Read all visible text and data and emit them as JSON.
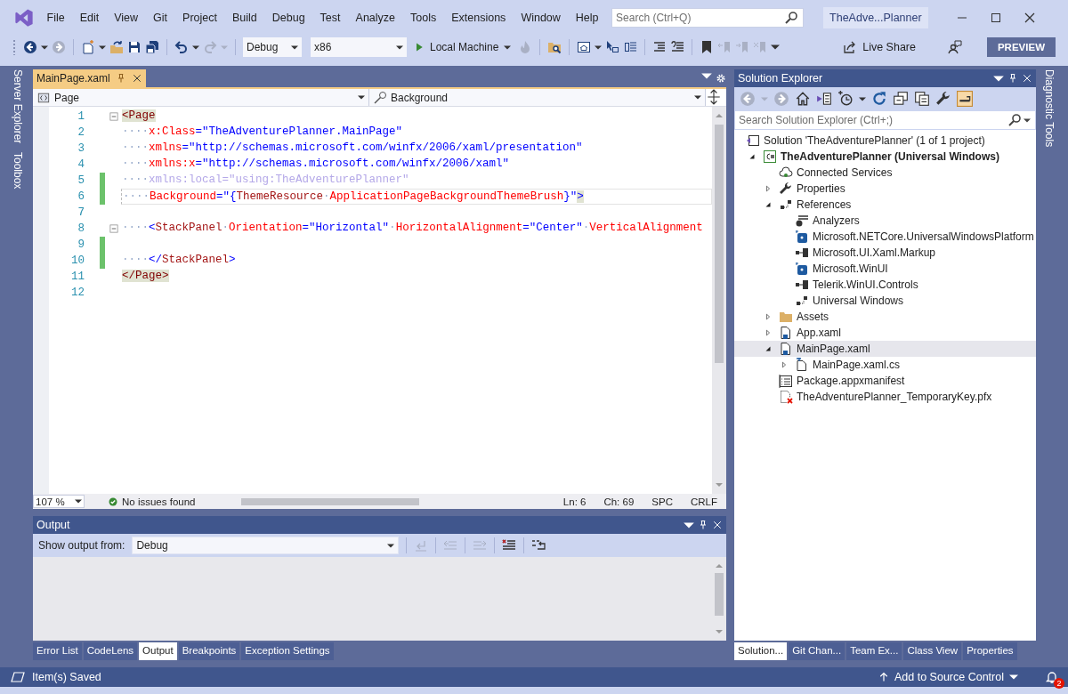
{
  "window": {
    "title": "TheAdve...Planner",
    "search": {
      "placeholder": "Search (Ctrl+Q)"
    }
  },
  "menu": [
    "File",
    "Edit",
    "View",
    "Git",
    "Project",
    "Build",
    "Debug",
    "Test",
    "Analyze",
    "Tools",
    "Extensions",
    "Window",
    "Help"
  ],
  "toolbar": {
    "left_groups": [
      [
        {
          "kind": "back",
          "disabled": false
        },
        {
          "kind": "forward",
          "disabled": true
        }
      ],
      [
        {
          "kind": "new-item",
          "disabled": false
        },
        {
          "kind": "open",
          "disabled": false
        },
        {
          "kind": "save",
          "disabled": false
        },
        {
          "kind": "save-all",
          "disabled": false
        }
      ],
      [
        {
          "kind": "undo",
          "disabled": false
        },
        {
          "kind": "redo",
          "disabled": true
        }
      ]
    ],
    "configuration": "Debug",
    "platform": "x86",
    "run_target": "Local Machine",
    "right_groups": [
      [
        {
          "kind": "flame",
          "disabled": true
        }
      ],
      [
        {
          "kind": "folder-search",
          "disabled": false
        }
      ],
      [
        {
          "kind": "window-home",
          "disabled": false
        },
        {
          "kind": "pointer",
          "disabled": false
        },
        {
          "kind": "list",
          "disabled": false
        }
      ],
      [
        {
          "kind": "indent",
          "disabled": false
        },
        {
          "kind": "comment",
          "disabled": false
        }
      ],
      [
        {
          "kind": "bookmark",
          "disabled": false
        },
        {
          "kind": "bookmark-prev",
          "disabled": true
        },
        {
          "kind": "bookmark-next",
          "disabled": true
        },
        {
          "kind": "bookmark-clear",
          "disabled": true
        }
      ]
    ],
    "live_share": "Live Share",
    "preview": "PREVIEW"
  },
  "side_tabs": {
    "left": [
      "Server Explorer",
      "Toolbox"
    ],
    "right": [
      "Diagnostic Tools"
    ]
  },
  "editor": {
    "tab": {
      "label": "MainPage.xaml",
      "selected": true
    },
    "nav": {
      "scope": "Page",
      "member": "Background"
    },
    "lines": [
      {
        "number": "1",
        "changed": false,
        "collapsible": true,
        "current": false,
        "tokens": [
          {
            "kind": "matched-tag",
            "text": "<Page"
          }
        ]
      },
      {
        "number": "2",
        "changed": false,
        "collapsible": false,
        "current": false,
        "tokens": [
          {
            "kind": "space",
            "text": "····"
          },
          {
            "kind": "attr",
            "text": "x:Class"
          },
          {
            "kind": "punct",
            "text": "="
          },
          {
            "kind": "value",
            "text": "\"TheAdventurePlanner.MainPage\""
          }
        ]
      },
      {
        "number": "3",
        "changed": false,
        "collapsible": false,
        "current": false,
        "tokens": [
          {
            "kind": "space",
            "text": "····"
          },
          {
            "kind": "attr",
            "text": "xmlns"
          },
          {
            "kind": "punct",
            "text": "="
          },
          {
            "kind": "value",
            "text": "\"http://schemas.microsoft.com/winfx/2006/xaml/presentation\""
          }
        ]
      },
      {
        "number": "4",
        "changed": false,
        "collapsible": false,
        "current": false,
        "tokens": [
          {
            "kind": "space",
            "text": "····"
          },
          {
            "kind": "attr",
            "text": "xmlns:x"
          },
          {
            "kind": "punct",
            "text": "="
          },
          {
            "kind": "value",
            "text": "\"http://schemas.microsoft.com/winfx/2006/xaml\""
          }
        ]
      },
      {
        "number": "5",
        "changed": true,
        "collapsible": false,
        "current": false,
        "tokens": [
          {
            "kind": "space",
            "text": "····"
          },
          {
            "kind": "faded",
            "text": "xmlns:local=\"using:TheAdventurePlanner\""
          }
        ]
      },
      {
        "number": "6",
        "changed": true,
        "collapsible": false,
        "current": true,
        "tokens": [
          {
            "kind": "space",
            "text": "····"
          },
          {
            "kind": "attr",
            "text": "Background"
          },
          {
            "kind": "punct",
            "text": "=\"{"
          },
          {
            "kind": "tag",
            "text": "ThemeResource"
          },
          {
            "kind": "space",
            "text": "·"
          },
          {
            "kind": "attr",
            "text": "ApplicationPageBackgroundThemeBrush"
          },
          {
            "kind": "punct",
            "text": "}\""
          },
          {
            "kind": "matched-punct",
            "text": ">"
          }
        ]
      },
      {
        "number": "7",
        "changed": false,
        "collapsible": false,
        "current": false
      },
      {
        "number": "8",
        "changed": false,
        "collapsible": true,
        "current": false,
        "tokens": [
          {
            "kind": "space",
            "text": "····"
          },
          {
            "kind": "punct",
            "text": "<"
          },
          {
            "kind": "tag",
            "text": "StackPanel"
          },
          {
            "kind": "space",
            "text": "·"
          },
          {
            "kind": "attr",
            "text": "Orientation"
          },
          {
            "kind": "punct",
            "text": "="
          },
          {
            "kind": "value",
            "text": "\"Horizontal\""
          },
          {
            "kind": "space",
            "text": "·"
          },
          {
            "kind": "attr",
            "text": "HorizontalAlignment"
          },
          {
            "kind": "punct",
            "text": "="
          },
          {
            "kind": "value",
            "text": "\"Center\""
          },
          {
            "kind": "space",
            "text": "·"
          },
          {
            "kind": "attr",
            "text": "VerticalAlignment"
          }
        ]
      },
      {
        "number": "9",
        "changed": true,
        "collapsible": false,
        "current": false
      },
      {
        "number": "10",
        "changed": true,
        "collapsible": false,
        "current": false,
        "tokens": [
          {
            "kind": "space",
            "text": "····"
          },
          {
            "kind": "punct",
            "text": "</"
          },
          {
            "kind": "tag",
            "text": "StackPanel"
          },
          {
            "kind": "punct",
            "text": ">"
          }
        ]
      },
      {
        "number": "11",
        "changed": false,
        "collapsible": false,
        "current": false,
        "tokens": [
          {
            "kind": "matched-tag",
            "text": "</Page>"
          }
        ]
      },
      {
        "number": "12",
        "changed": false,
        "collapsible": false,
        "current": false
      }
    ],
    "zoom": "107 %",
    "issues": "No issues found",
    "line": "Ln: 6",
    "column": "Ch: 69",
    "whitespace": "SPC",
    "line_ending": "CRLF"
  },
  "output": {
    "title": "Output",
    "source_label": "Show output from:",
    "source": "Debug",
    "tools": [
      {
        "kind": "goto-source",
        "disabled": true
      },
      {
        "kind": "prev-message",
        "disabled": true
      },
      {
        "kind": "next-message",
        "disabled": true
      },
      {
        "kind": "clear-all",
        "disabled": false
      },
      {
        "kind": "word-wrap",
        "disabled": false
      }
    ],
    "tabs": [
      {
        "label": "Error List",
        "selected": false
      },
      {
        "label": "CodeLens",
        "selected": false
      },
      {
        "label": "Output",
        "selected": true
      },
      {
        "label": "Breakpoints",
        "selected": false
      },
      {
        "label": "Exception Settings",
        "selected": false
      }
    ]
  },
  "solution": {
    "title": "Solution Explorer",
    "tools": [
      {
        "kind": "back",
        "disabled": true,
        "on": false
      },
      {
        "kind": "forward",
        "disabled": true,
        "on": false
      },
      {
        "kind": "home",
        "disabled": false,
        "on": false
      },
      {
        "kind": "vs-switch",
        "disabled": false,
        "on": false
      },
      {
        "kind": "history",
        "disabled": false,
        "on": false
      },
      {
        "kind": "refresh",
        "disabled": false,
        "on": false
      },
      {
        "kind": "collapse",
        "disabled": false,
        "on": false
      },
      {
        "kind": "copy",
        "disabled": false,
        "on": false
      },
      {
        "kind": "wrench",
        "disabled": false,
        "on": false
      },
      {
        "kind": "pending",
        "disabled": false,
        "on": true
      }
    ],
    "search": {
      "placeholder": "Search Solution Explorer (Ctrl+;)"
    },
    "tree": [
      {
        "label": "Solution 'TheAdventurePlanner' (1 of 1 project)",
        "kind": "solution",
        "selected": false,
        "children": [
          {
            "label": "TheAdventurePlanner (Universal Windows)",
            "kind": "project",
            "expanded": true,
            "selected": false,
            "children": [
              {
                "label": "Connected Services",
                "kind": "cloud",
                "selected": false
              },
              {
                "label": "Properties",
                "kind": "properties",
                "expanded": false,
                "selected": false
              },
              {
                "label": "References",
                "kind": "references",
                "expanded": true,
                "selected": false,
                "children": [
                  {
                    "label": "Analyzers",
                    "kind": "analyzer",
                    "selected": false
                  },
                  {
                    "label": "Microsoft.NETCore.UniversalWindowsPlatform",
                    "kind": "package",
                    "selected": false
                  },
                  {
                    "label": "Microsoft.UI.Xaml.Markup",
                    "kind": "assembly",
                    "selected": false
                  },
                  {
                    "label": "Microsoft.WinUI",
                    "kind": "package",
                    "selected": false
                  },
                  {
                    "label": "Telerik.WinUI.Controls",
                    "kind": "assembly",
                    "selected": false
                  },
                  {
                    "label": "Universal Windows",
                    "kind": "references",
                    "selected": false
                  }
                ]
              },
              {
                "label": "Assets",
                "kind": "folder",
                "expanded": false,
                "selected": false
              },
              {
                "label": "App.xaml",
                "kind": "xaml",
                "expanded": false,
                "selected": false
              },
              {
                "label": "MainPage.xaml",
                "kind": "xaml",
                "expanded": true,
                "selected": true,
                "children": [
                  {
                    "label": "MainPage.xaml.cs",
                    "kind": "code",
                    "expanded": false,
                    "selected": false
                  }
                ]
              },
              {
                "label": "Package.appxmanifest",
                "kind": "manifest",
                "selected": false
              },
              {
                "label": "TheAdventurePlanner_TemporaryKey.pfx",
                "kind": "certificate",
                "selected": false
              }
            ]
          }
        ]
      }
    ],
    "tabs": [
      {
        "label": "Solution...",
        "selected": true
      },
      {
        "label": "Git Chan...",
        "selected": false
      },
      {
        "label": "Team Ex...",
        "selected": false
      },
      {
        "label": "Class View",
        "selected": false
      },
      {
        "label": "Properties",
        "selected": false
      }
    ]
  },
  "status_bar": {
    "message": "Item(s) Saved",
    "source_control": "Add to Source Control",
    "notifications": "2"
  }
}
